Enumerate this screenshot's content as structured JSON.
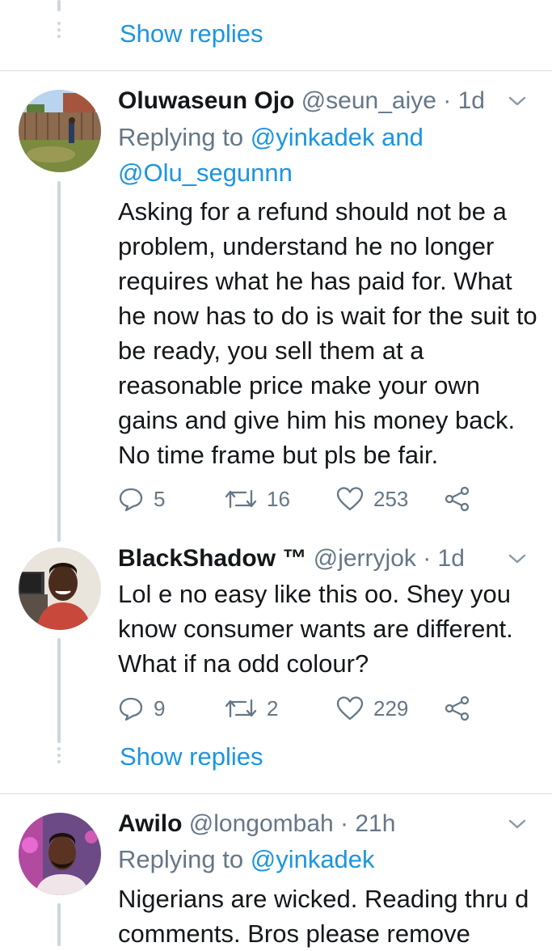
{
  "show_replies_label": "Show replies",
  "colors": {
    "accent": "#1b95e0",
    "secondary": "#657786",
    "thread_line": "#ccd6dd"
  },
  "tweets": [
    {
      "name": "Oluwaseun Ojo",
      "handle": "@seun_aiye",
      "time": "· 1d",
      "replying_prefix": "Replying to ",
      "replying_mention1": "@yinkadek",
      "replying_and": " and",
      "replying_mention2": "@Olu_segunnn",
      "text": "Asking for a refund should not be a problem, understand he no longer requires what he has paid for. What he now has to do is wait for the suit to be ready, you sell them at a reasonable price make your own gains and give him his money back. No time frame but pls be fair.",
      "replies": "5",
      "retweets": "16",
      "likes": "253"
    },
    {
      "name": "BlackShadow ™",
      "handle": "@jerryjok",
      "time": "· 1d",
      "text": "Lol e no easy like this  oo. Shey you know consumer wants are different. What if na odd colour?",
      "replies": "9",
      "retweets": "2",
      "likes": "229"
    },
    {
      "name": "Awilo",
      "handle": "@longombah",
      "time": "· 21h",
      "replying_prefix": "Replying to ",
      "replying_mention1": "@yinkadek",
      "text": "Nigerians are wicked. Reading thru d comments. Bros please remove"
    }
  ],
  "icons": [
    "reply-icon",
    "retweet-icon",
    "like-icon",
    "share-icon",
    "chevron-down-icon"
  ]
}
